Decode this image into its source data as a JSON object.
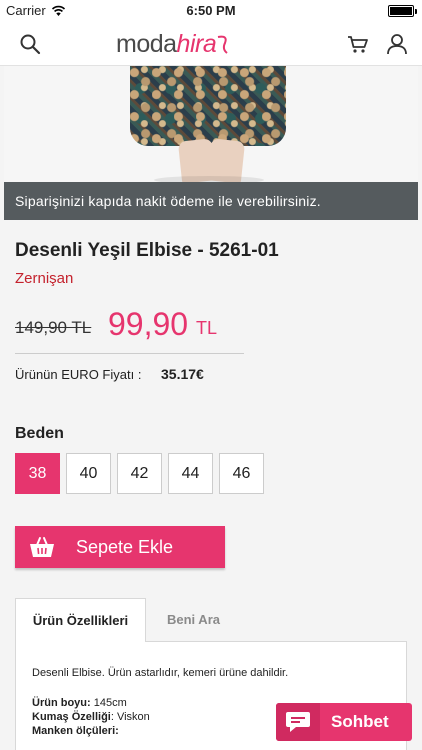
{
  "status_bar": {
    "carrier": "Carrier",
    "time": "6:50 PM"
  },
  "navbar": {
    "logo_part1": "moda",
    "logo_part2": "hira",
    "icons": [
      "search-icon",
      "cart-icon",
      "user-icon"
    ]
  },
  "banner": {
    "text": "Siparişinizi kapıda nakit ödeme ile verebilirsiniz."
  },
  "product": {
    "title": "Desenli Yeşil Elbise - 5261-01",
    "brand": "Zernişan",
    "old_price": "149,90 TL",
    "new_price": "99,90",
    "currency": "TL",
    "euro_label": "Ürünün EURO Fiyatı :",
    "euro_value": "35.17€"
  },
  "sizes": {
    "label": "Beden",
    "options": [
      "38",
      "40",
      "42",
      "44",
      "46"
    ],
    "selected": "38"
  },
  "cart_button": {
    "label": "Sepete Ekle",
    "icon": "basket-icon"
  },
  "tabs": {
    "items": [
      {
        "label": "Ürün Özellikleri",
        "active": true
      },
      {
        "label": "Beni Ara",
        "active": false
      }
    ],
    "panel": {
      "description": "Desenli Elbise. Ürün astarlıdır, kemeri ürüne dahildir.",
      "specs": [
        {
          "key": "Ürün boyu:",
          "value": " 145cm"
        },
        {
          "key": "Kumaş Özelliği",
          "value": ": Viskon"
        },
        {
          "key": "Manken ölçüleri:",
          "value": ""
        }
      ]
    }
  },
  "chat": {
    "label": "Sohbet",
    "icon": "chat-bubble-icon"
  },
  "colors": {
    "accent": "#e6356e",
    "brand_red": "#c4222d",
    "banner_bg": "#555b5e"
  }
}
